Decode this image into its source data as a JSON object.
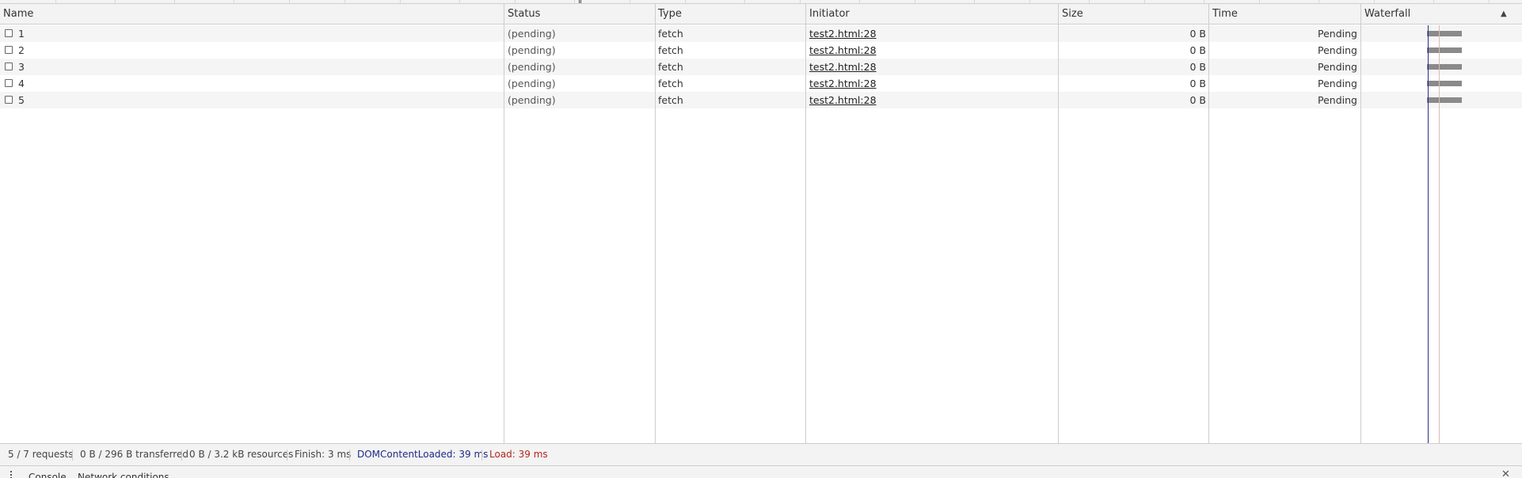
{
  "table": {
    "columns": [
      "Name",
      "Status",
      "Type",
      "Initiator",
      "Size",
      "Time",
      "Waterfall"
    ],
    "sort_indicator": "▲",
    "rows": [
      {
        "name": "1",
        "status": "(pending)",
        "type": "fetch",
        "initiator": "test2.html:28",
        "size": "0 B",
        "time": "Pending"
      },
      {
        "name": "2",
        "status": "(pending)",
        "type": "fetch",
        "initiator": "test2.html:28",
        "size": "0 B",
        "time": "Pending"
      },
      {
        "name": "3",
        "status": "(pending)",
        "type": "fetch",
        "initiator": "test2.html:28",
        "size": "0 B",
        "time": "Pending"
      },
      {
        "name": "4",
        "status": "(pending)",
        "type": "fetch",
        "initiator": "test2.html:28",
        "size": "0 B",
        "time": "Pending"
      },
      {
        "name": "5",
        "status": "(pending)",
        "type": "fetch",
        "initiator": "test2.html:28",
        "size": "0 B",
        "time": "Pending"
      }
    ]
  },
  "summary": {
    "requests": "5 / 7 requests",
    "transferred": "0 B / 296 B transferred",
    "resources": "0 B / 3.2 kB resources",
    "finish": "Finish: 3 ms",
    "dom_content_loaded": "DOMContentLoaded: 39 ms",
    "load": "Load: 39 ms",
    "colors": {
      "dom_content_loaded": "#1f2a85",
      "load": "#b3261e"
    }
  },
  "drawer": {
    "tabs": [
      "Console",
      "Network conditions"
    ],
    "menu_icon": "kebab-menu-icon",
    "close_icon": "close-icon"
  }
}
